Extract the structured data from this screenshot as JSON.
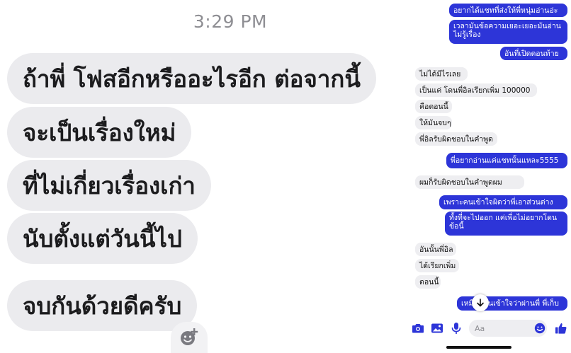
{
  "left_panel": {
    "timestamp": "3:29 PM",
    "bubbles": [
      "ถ้าพี่ โฟสอีกหรืออะไรอีก ต่อจากนี้",
      "จะเป็นเรื่องใหม่",
      "ที่ไม่เกี่ยวเรื่องเก่า",
      "นับตั้งแต่วันนี้ไป",
      "จบกันด้วยดีครับ"
    ],
    "reaction_icon": "add-reaction-icon"
  },
  "right_panel": {
    "messages": [
      {
        "side": "sent",
        "text": "อยากได้แชทที่ส่งให้พี่หนุ่มอ่านอ่ะ"
      },
      {
        "side": "sent",
        "text": "เวลามันข้อความเยอะเยอะมันอ่านไม่รู้เรื่อง"
      },
      {
        "side": "sent",
        "text": "อันที่เปิดตอนท้าย"
      },
      {
        "side": "recv",
        "text": "ไม่ได้มีไรเลย"
      },
      {
        "side": "recv",
        "text": "เป็นแค่ โดนพี่อิลเรียกเพิ่ม 100000"
      },
      {
        "side": "recv",
        "text": "คือตอนนี้"
      },
      {
        "side": "recv",
        "text": "ให้มันจบๆ"
      },
      {
        "side": "recv",
        "text": "พี่อิลรับผิดชอบในคำพูด"
      },
      {
        "side": "sent",
        "text": "พี่อยากอ่านแค่แชทนั้นแหละ5555"
      },
      {
        "side": "recv",
        "text": "ผมก็รับผิดชอบในคำพูดผม"
      },
      {
        "side": "sent",
        "text": "เพราะคนเข้าใจผิดว่าพี่เอาส่วนต่าง"
      },
      {
        "side": "sent",
        "text": "ทั้งที่จะไปออก แค่เพื่อไม่อยากโดนข้อนี้"
      },
      {
        "side": "recv",
        "text": "อันนั้นพี่อิล"
      },
      {
        "side": "recv",
        "text": "ได้เรียกเพิ่ม"
      },
      {
        "side": "recv",
        "text": "ตอนนี้"
      },
      {
        "side": "sent",
        "text": "เหมือนคนเข้าใจว่าผ่านพี่ พี่เก็บ"
      }
    ],
    "composer": {
      "placeholder": "Aa",
      "tools": [
        "camera-icon",
        "image-icon",
        "microphone-icon",
        "emoji-icon",
        "like-icon"
      ]
    },
    "accent_color": "#2d35d8"
  }
}
